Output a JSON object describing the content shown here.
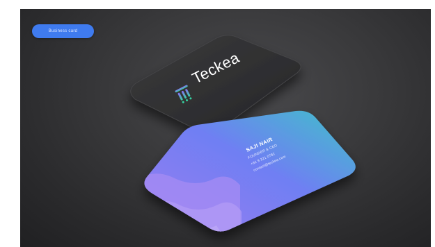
{
  "badge": {
    "label": "Business card"
  },
  "card_front": {
    "logo_text": "Teckea",
    "colors": {
      "card": "#2f2f31",
      "logo_text": "#ffffff",
      "logo_accent": "#3fa7ff",
      "mark_top": "#8a6cf7",
      "mark_bottom": "#35d3a3"
    }
  },
  "card_back": {
    "name": "SAJI NAIR",
    "title": "FOUNDER & CEO",
    "phone": "+91 9 321 0782",
    "email": "contact@teckea.com",
    "colors": {
      "gradient_start": "#9b7df1",
      "gradient_mid": "#6f7ff3",
      "gradient_end": "#3fc1c9",
      "wave": "#a58cf3"
    }
  }
}
